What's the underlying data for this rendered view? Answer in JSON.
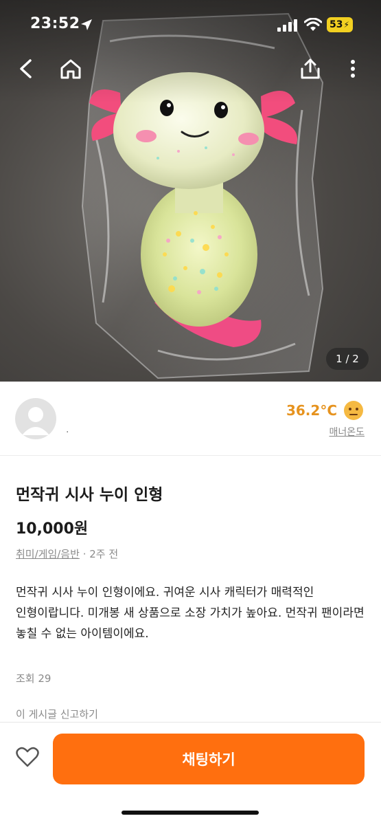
{
  "status_bar": {
    "time": "23:52",
    "battery": "53",
    "icons": [
      "location-arrow-icon",
      "cellular-signal-icon",
      "wifi-icon",
      "battery-charging-icon"
    ]
  },
  "nav": {
    "icons": [
      "back-arrow-icon",
      "home-icon",
      "share-icon",
      "more-vertical-icon"
    ]
  },
  "image": {
    "description_alt": "",
    "page_indicator": "1 / 2"
  },
  "seller": {
    "name": "",
    "location": "·",
    "temperature": "36.2°C",
    "temperature_color": "#e6931f",
    "manner_label": "매너온도"
  },
  "product": {
    "title": "먼작귀 시사 누이 인형",
    "price": "10,000원",
    "category": "취미/게임/음반",
    "separator": " · ",
    "posted": "2주 전",
    "description": "먼작귀 시사 누이 인형이에요. 귀여운 시사 캐릭터가 매력적인 인형이랍니다. 미개봉 새 상품으로 소장 가치가 높아요. 먼작귀 팬이라면 놓칠 수 없는 아이템이에요.",
    "views": "조회 29",
    "report": "이 게시글 신고하기"
  },
  "bottom": {
    "chat_label": "채팅하기",
    "accent": "#ff6f0f"
  }
}
